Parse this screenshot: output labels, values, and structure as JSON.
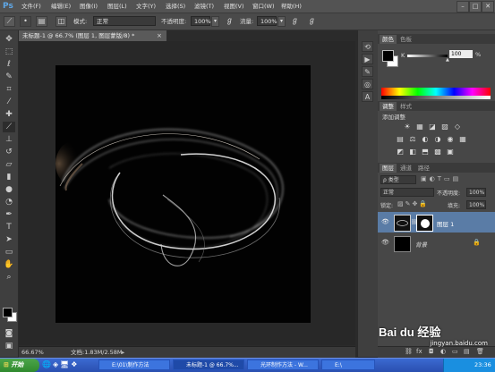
{
  "app": {
    "logo": "Ps"
  },
  "menu": [
    "文件(F)",
    "编辑(E)",
    "图像(I)",
    "图层(L)",
    "文字(Y)",
    "选择(S)",
    "滤镜(T)",
    "视图(V)",
    "窗口(W)",
    "帮助(H)"
  ],
  "window_controls": [
    "–",
    "□",
    "✕"
  ],
  "options": {
    "mode_label": "模式:",
    "mode_value": "正常",
    "opacity_label": "不透明度:",
    "opacity_value": "100%",
    "flow_label": "流量:",
    "flow_value": "100%"
  },
  "document": {
    "tab_title": "未标题-1 @ 66.7% (图层 1, 图层蒙版/8) *",
    "zoom": "66.67%",
    "doc_size": "文档:1.83M/2.58M"
  },
  "color_panel": {
    "tabs": [
      "颜色",
      "色板"
    ],
    "channel_label": "K",
    "channel_value": "100",
    "channel_unit": "%",
    "foreground": "#000000",
    "background": "#ffffff"
  },
  "adjust_panel": {
    "tabs": [
      "调整",
      "样式"
    ],
    "heading": "添加调整",
    "icons_row1": [
      "☀",
      "▦",
      "◪",
      "▨",
      "◇"
    ],
    "icons_row2": [
      "▤",
      "⚖",
      "◐",
      "◑",
      "◉",
      "▦"
    ],
    "icons_row3": [
      "◩",
      "◧",
      "⬒",
      "▩",
      "▣"
    ]
  },
  "layers_panel": {
    "tabs": [
      "图层",
      "通道",
      "路径"
    ],
    "filter": "ρ 类型",
    "blend_mode": "正常",
    "opacity_label": "不透明度:",
    "opacity_value": "100%",
    "lock_label": "锁定:",
    "fill_label": "填充:",
    "fill_value": "100%",
    "layers": [
      {
        "name": "图层 1",
        "has_mask": true,
        "selected": true
      },
      {
        "name": "背景",
        "has_mask": false,
        "selected": false,
        "locked": true
      }
    ],
    "footer_icons": [
      "⛓",
      "fx",
      "◘",
      "◐",
      "▭",
      "▤",
      "🗑"
    ]
  },
  "taskbar": {
    "start": "开始",
    "tasks": [
      {
        "label": "E:\\01\\制作方法"
      },
      {
        "label": "未标题-1 @ 66.7%..."
      },
      {
        "label": "光环制作方法 - W..."
      },
      {
        "label": "E:\\"
      }
    ],
    "clock": "23:36"
  },
  "watermark": {
    "brand": "Bai du 经验",
    "url": "jingyan.baidu.com"
  },
  "colors": {
    "accent": "#2a4fb0",
    "selection": "#5a7ca6",
    "panel_bg": "#474747",
    "canvas": "#020202"
  }
}
